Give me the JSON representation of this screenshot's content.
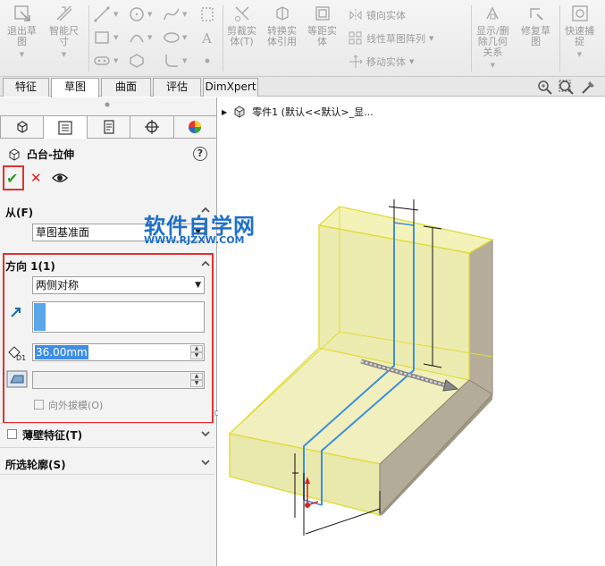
{
  "ribbon": {
    "exit_sketch": "退出草\n图",
    "smart_dim": "智能尺\n寸",
    "trim": "剪裁实\n体(T)",
    "convert": "转换实\n体引用",
    "offset": "等距实\n体",
    "mirror": "镜向实体",
    "linear_pattern": "线性草图阵列",
    "move": "移动实体",
    "show_hide": "显示/删\n除几何\n关系",
    "repair": "修复草\n图",
    "quick_snap": "快速捕\n捉"
  },
  "tabs": [
    "特征",
    "草图",
    "曲面",
    "评估",
    "DimXpert"
  ],
  "active_tab": 1,
  "feature": {
    "title": "凸台-拉伸",
    "help": "?"
  },
  "from": {
    "label": "从(F)",
    "value": "草图基准面"
  },
  "direction1": {
    "label": "方向 1(1)",
    "end_condition": "两侧对称",
    "depth": "36.00mm",
    "depth_tag": "D1",
    "draft_outward": "向外拔模(O)"
  },
  "thin_feature": "薄壁特征(T)",
  "selected_contours": "所选轮廓(S)",
  "viewport": {
    "tree_item": "零件1  (默认<<默认>_显..."
  },
  "watermark": {
    "line1": "软件自学网",
    "line2": "WWW.RJZXW.COM"
  },
  "colors": {
    "accent_red": "#e03131",
    "ok_green": "#2a9d2a",
    "highlight_blue": "#3e8ee6",
    "preview_yellow": "#ecec9a",
    "sketch_blue": "#3c8fdc"
  }
}
